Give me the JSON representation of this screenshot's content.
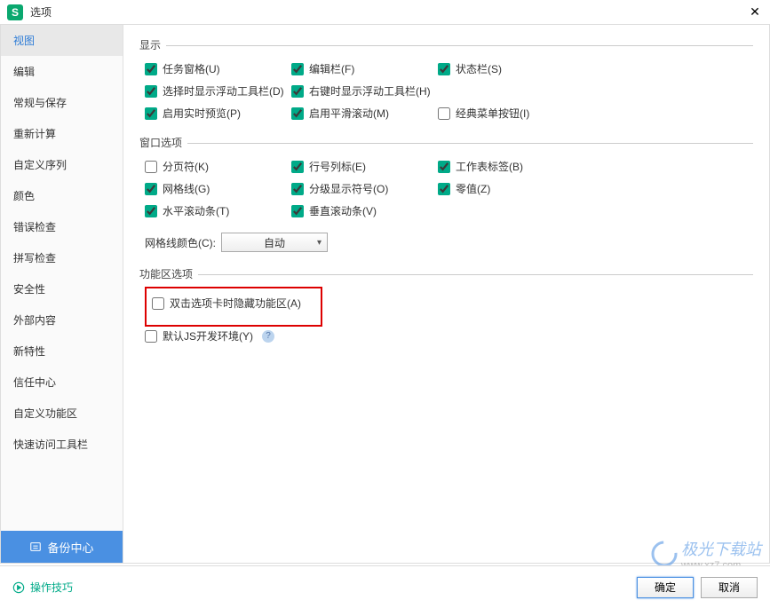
{
  "window": {
    "title": "选项"
  },
  "sidebar": {
    "items": [
      {
        "label": "视图",
        "active": true
      },
      {
        "label": "编辑"
      },
      {
        "label": "常规与保存"
      },
      {
        "label": "重新计算"
      },
      {
        "label": "自定义序列"
      },
      {
        "label": "颜色"
      },
      {
        "label": "错误检查"
      },
      {
        "label": "拼写检查"
      },
      {
        "label": "安全性"
      },
      {
        "label": "外部内容"
      },
      {
        "label": "新特性"
      },
      {
        "label": "信任中心"
      },
      {
        "label": "自定义功能区"
      },
      {
        "label": "快速访问工具栏"
      }
    ],
    "backup_label": "备份中心"
  },
  "sections": {
    "display": {
      "title": "显示",
      "opts": [
        {
          "label": "任务窗格(U)",
          "checked": true
        },
        {
          "label": "编辑栏(F)",
          "checked": true
        },
        {
          "label": "状态栏(S)",
          "checked": true
        },
        {
          "label": "选择时显示浮动工具栏(D)",
          "checked": true
        },
        {
          "label": "右键时显示浮动工具栏(H)",
          "checked": true
        },
        {
          "label": "",
          "checked": false,
          "empty": true
        },
        {
          "label": "启用实时预览(P)",
          "checked": true
        },
        {
          "label": "启用平滑滚动(M)",
          "checked": true
        },
        {
          "label": "经典菜单按钮(I)",
          "checked": false
        }
      ]
    },
    "window_opts": {
      "title": "窗口选项",
      "opts": [
        {
          "label": "分页符(K)",
          "checked": false
        },
        {
          "label": "行号列标(E)",
          "checked": true
        },
        {
          "label": "工作表标签(B)",
          "checked": true
        },
        {
          "label": "网格线(G)",
          "checked": true
        },
        {
          "label": "分级显示符号(O)",
          "checked": true
        },
        {
          "label": "零值(Z)",
          "checked": true
        },
        {
          "label": "水平滚动条(T)",
          "checked": true
        },
        {
          "label": "垂直滚动条(V)",
          "checked": true
        }
      ],
      "grid_color_label": "网格线颜色(C):",
      "grid_color_value": "自动"
    },
    "ribbon": {
      "title": "功能区选项",
      "opts": [
        {
          "label": "双击选项卡时隐藏功能区(A)",
          "checked": false,
          "highlight": true
        },
        {
          "label": "默认JS开发环境(Y)",
          "checked": false,
          "help": true
        }
      ]
    }
  },
  "footer": {
    "tips": "操作技巧",
    "ok": "确定",
    "cancel": "取消"
  },
  "watermark": {
    "main": "极光下载站",
    "sub": "www.xz7.com"
  }
}
